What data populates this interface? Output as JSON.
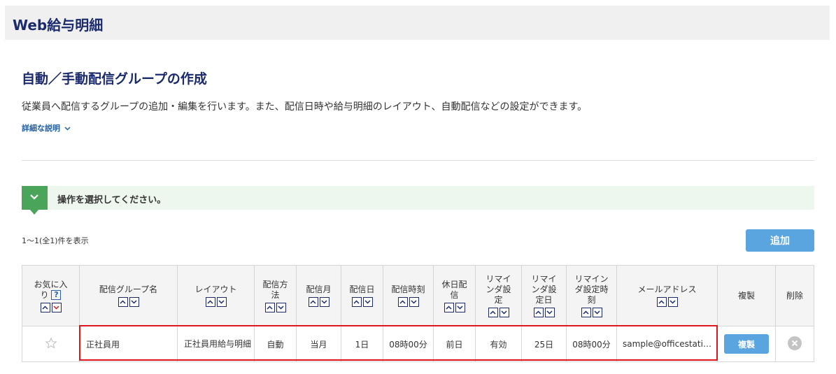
{
  "header": {
    "app_title": "Web給与明細"
  },
  "page": {
    "title": "自動／手動配信グループの作成",
    "description": "従業員へ配信するグループの追加・編集を行います。また、配信日時や給与明細のレイアウト、自動配信などの設定ができます。",
    "detail_link": "詳細な説明",
    "operation_prompt": "操作を選択してください。",
    "result_count": "1〜1(全1)件を表示",
    "add_button": "追加"
  },
  "table": {
    "headers": {
      "favorite": "お気に入り",
      "group_name": "配信グループ名",
      "layout": "レイアウト",
      "method": "配信方法",
      "month": "配信月",
      "day": "配信日",
      "time": "配信時刻",
      "holiday": "休日配信",
      "reminder_setting": "リマインダ設定",
      "reminder_day": "リマインダ設定日",
      "reminder_time": "リマインダ設定時刻",
      "email": "メールアドレス",
      "copy": "複製",
      "delete": "削除"
    },
    "row": {
      "group_name": "正社員用",
      "layout": "正社員用給与明細",
      "method": "自動",
      "month": "当月",
      "day": "1日",
      "time": "08時00分",
      "holiday": "前日",
      "reminder_setting": "有効",
      "reminder_day": "25日",
      "reminder_time": "08時00分",
      "email": "sample@officestati…",
      "copy_button": "複製"
    }
  },
  "colors": {
    "accent": "#5aa5df",
    "title": "#1a2a6c",
    "highlight": "#e0151c",
    "success": "#4aa55a"
  }
}
